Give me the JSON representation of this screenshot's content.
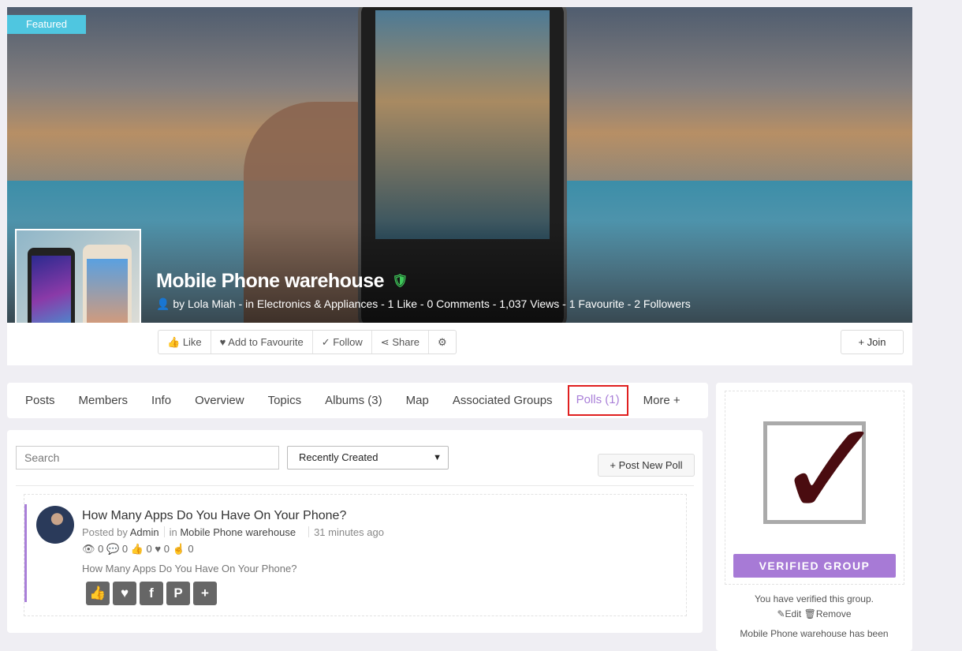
{
  "badge": "Featured",
  "group": {
    "title": "Mobile Phone warehouse",
    "meta": "by Lola Miah - in Electronics & Appliances - 1 Like - 0 Comments - 1,037 Views - 1 Favourite - 2 Followers"
  },
  "actions": {
    "like": "Like",
    "favourite": "Add to Favourite",
    "follow": "Follow",
    "share": "Share",
    "join": "Join"
  },
  "tabs": [
    "Posts",
    "Members",
    "Info",
    "Overview",
    "Topics",
    "Albums (3)",
    "Map",
    "Associated Groups",
    "Polls (1)",
    "More +"
  ],
  "active_tab": "Polls (1)",
  "toolbar": {
    "search_placeholder": "Search",
    "sort": "Recently Created",
    "post_new": "Post New Poll"
  },
  "poll": {
    "title": "How Many Apps Do You Have On Your Phone?",
    "posted_by_label": "Posted by",
    "author": "Admin",
    "in_label": "in",
    "group": "Mobile Phone warehouse",
    "time": "31 minutes ago",
    "views": "0",
    "comments": "0",
    "likes": "0",
    "favourites": "0",
    "votes": "0",
    "description": "How Many Apps Do You Have On Your Phone?"
  },
  "sidebar": {
    "verified_label": "VERIFIED GROUP",
    "verified_text": "You have verified this group.",
    "edit": "Edit",
    "remove": "Remove",
    "description": "Mobile Phone warehouse has been"
  },
  "colors": {
    "accent": "#a77ad6",
    "featured": "#4fc6e0",
    "highlight": "#e02020"
  }
}
